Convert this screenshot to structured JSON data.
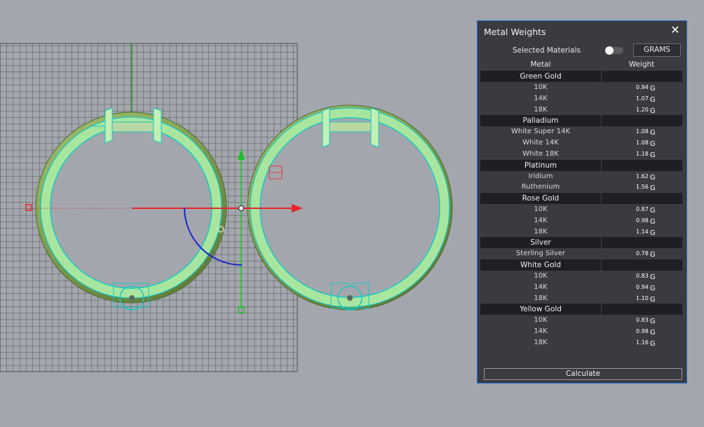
{
  "panel": {
    "title": "Metal Weights",
    "selected_label": "Selected Materials",
    "toggle_on": false,
    "units_label": "GRAMS",
    "col_metal": "Metal",
    "col_weight": "Weight",
    "calculate_label": "Calculate",
    "unit_suffix": "G",
    "groups": [
      {
        "name": "Green Gold",
        "items": [
          {
            "label": "10K",
            "weight": "0.94"
          },
          {
            "label": "14K",
            "weight": "1.07"
          },
          {
            "label": "18K",
            "weight": "1.20"
          }
        ]
      },
      {
        "name": "Palladium",
        "items": [
          {
            "label": "White Super 14K",
            "weight": "1.08"
          },
          {
            "label": "White 14K",
            "weight": "1.08"
          },
          {
            "label": "White 18K",
            "weight": "1.18"
          }
        ]
      },
      {
        "name": "Platinum",
        "items": [
          {
            "label": "Iridium",
            "weight": "1.62"
          },
          {
            "label": "Ruthenium",
            "weight": "1.56"
          }
        ]
      },
      {
        "name": "Rose Gold",
        "items": [
          {
            "label": "10K",
            "weight": "0.87"
          },
          {
            "label": "14K",
            "weight": "0.98"
          },
          {
            "label": "18K",
            "weight": "1.14"
          }
        ]
      },
      {
        "name": "Silver",
        "items": [
          {
            "label": "Sterling Silver",
            "weight": "0.78"
          }
        ]
      },
      {
        "name": "White Gold",
        "items": [
          {
            "label": "10K",
            "weight": "0.83"
          },
          {
            "label": "14K",
            "weight": "0.94"
          },
          {
            "label": "18K",
            "weight": "1.10"
          }
        ]
      },
      {
        "name": "Yellow Gold",
        "items": [
          {
            "label": "10K",
            "weight": "0.83"
          },
          {
            "label": "14K",
            "weight": "0.98"
          },
          {
            "label": "18K",
            "weight": "1.16"
          }
        ]
      }
    ]
  },
  "colors": {
    "background": "#a3a7ad",
    "panel_bg": "#3a3b3f",
    "group_bg": "#1e1f22",
    "ring_fill": "#a8e6a0",
    "ring_edge": "#19c7c0",
    "ring_body": "#7a9a55",
    "axis_x": "#e8242a",
    "axis_y": "#1fbf2a"
  }
}
